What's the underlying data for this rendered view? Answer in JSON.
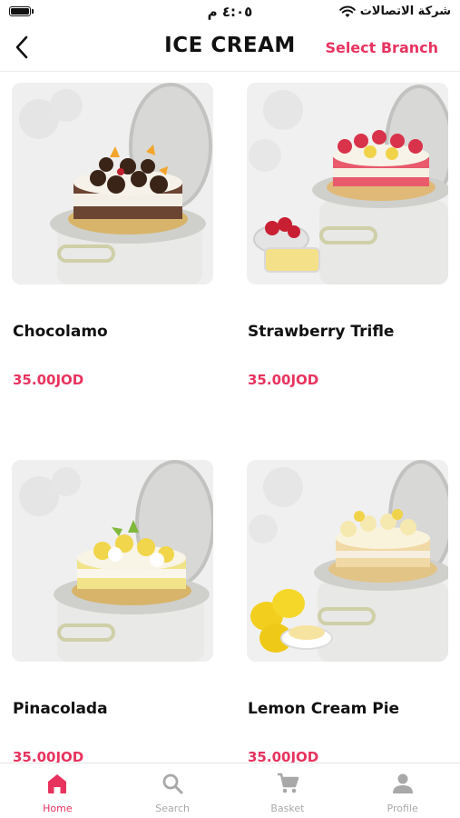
{
  "status_bar": {
    "time": "٤:٠٥ م",
    "carrier": "شركة الاتصالات",
    "battery_level": 1.0
  },
  "header": {
    "back_icon": "chevron-left-icon",
    "title": "ICE CREAM",
    "action_label": "Select Branch"
  },
  "colors": {
    "accent": "#e8335f",
    "inactive": "#a8a8a8",
    "text": "#111111"
  },
  "products": [
    {
      "name": "Chocolamo",
      "price": "35.00JOD",
      "image": "chocolate-cake-photo"
    },
    {
      "name": "Strawberry Trifle",
      "price": "35.00JOD",
      "image": "strawberry-cake-photo"
    },
    {
      "name": "Pinacolada",
      "price": "35.00JOD",
      "image": "pinacolada-cake-photo"
    },
    {
      "name": "Lemon Cream Pie",
      "price": "35.00JOD",
      "image": "lemon-cake-photo"
    }
  ],
  "tabs": [
    {
      "label": "Home",
      "icon": "home-icon",
      "active": true
    },
    {
      "label": "Search",
      "icon": "search-icon",
      "active": false
    },
    {
      "label": "Basket",
      "icon": "cart-icon",
      "active": false
    },
    {
      "label": "Profile",
      "icon": "person-icon",
      "active": false
    }
  ]
}
